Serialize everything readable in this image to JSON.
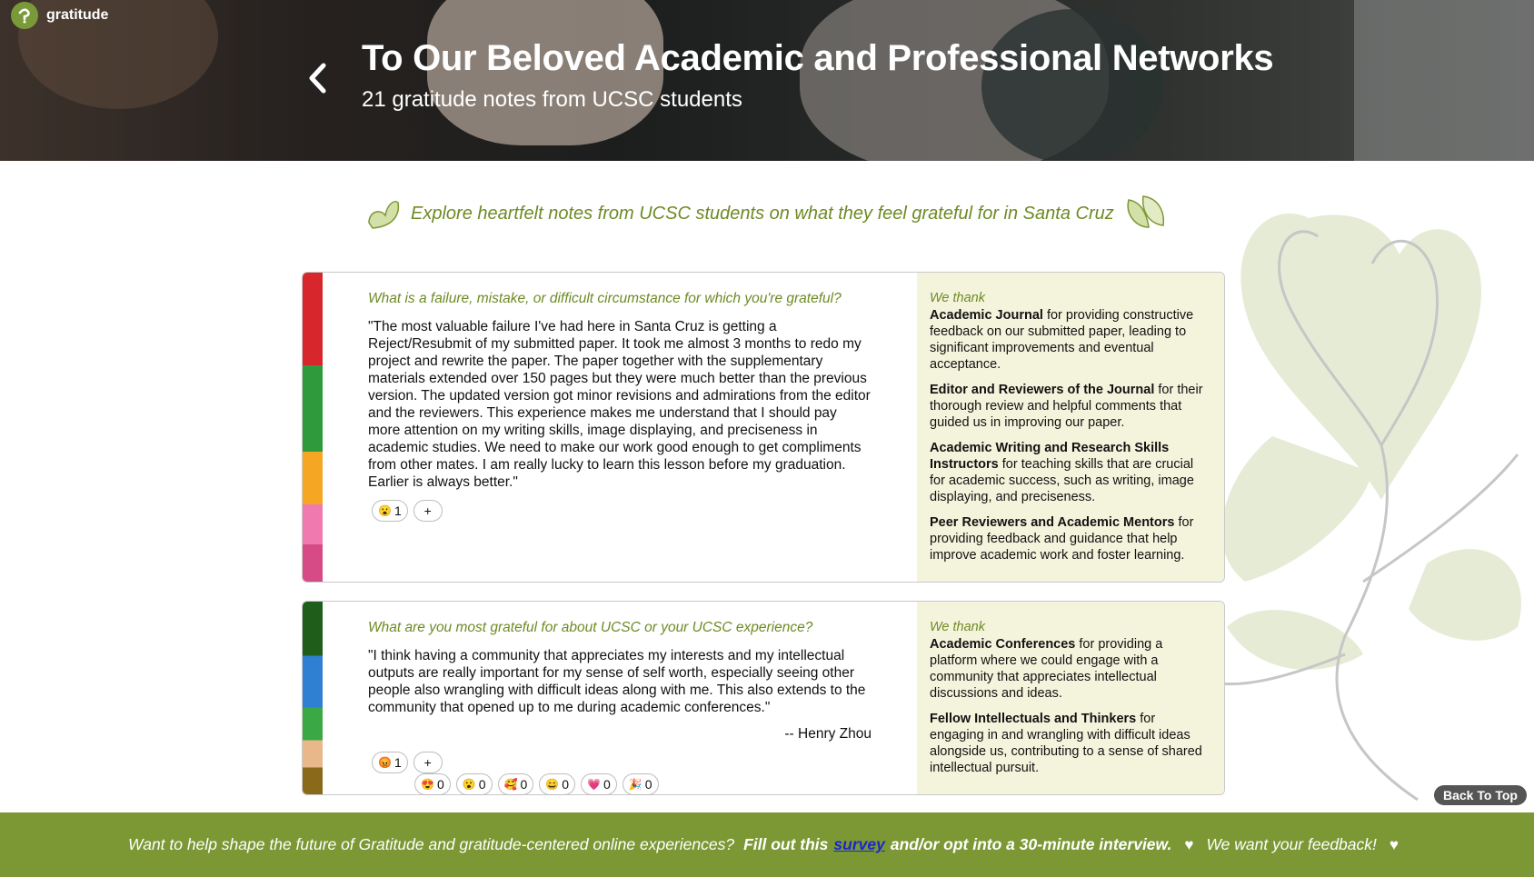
{
  "brand": {
    "name": "gratitude"
  },
  "header": {
    "title": "To Our Beloved Academic and Professional Networks",
    "subtitle": "21 gratitude notes from UCSC students"
  },
  "tagline": "Explore heartfelt notes from UCSC students on what they feel grateful for in Santa Cruz",
  "cards": [
    {
      "question": "What is a failure, mistake, or difficult circumstance for which you're grateful?",
      "answer": "\"The most valuable failure I've had here in Santa Cruz is getting a Reject/Resubmit of my submitted paper. It took me almost 3 months to redo my project and rewrite the paper. The paper together with the supplementary materials extended over 150 pages but they were much better than the previous version. The updated version got minor revisions and admirations from the editor and the reviewers. This experience makes me understand that I should pay more attention on my writing skills, image displaying, and preciseness in academic studies. We need to make our work good enough to get compliments from other mates. I am really lucky to learn this lesson before my graduation. Earlier is always better.\"",
      "reaction": {
        "emoji": "😮",
        "count": "1"
      },
      "add_label": "+",
      "we_thank_label": "We thank",
      "thanks": [
        {
          "name": "Academic Journal",
          "text": " for providing constructive feedback on our submitted paper, leading to significant improvements and eventual acceptance."
        },
        {
          "name": "Editor and Reviewers of the Journal",
          "text": " for their thorough review and helpful comments that guided us in improving our paper."
        },
        {
          "name": "Academic Writing and Research Skills Instructors",
          "text": " for teaching skills that are crucial for academic success, such as writing, image displaying, and preciseness."
        },
        {
          "name": "Peer Reviewers and Academic Mentors",
          "text": " for providing feedback and guidance that help improve academic work and foster learning."
        }
      ]
    },
    {
      "question": "What are you most grateful for about UCSC or your UCSC experience?",
      "answer": "\"I think having a community that appreciates my interests and my intellectual outputs are really important for my sense of self worth, especially seeing other people also wrangling with difficult ideas along with me. This also extends to the community that opened up to me during academic conferences.\"",
      "author": "-- Henry Zhou",
      "reaction": {
        "emoji": "😡",
        "count": "1"
      },
      "add_label": "+",
      "picker": [
        {
          "emoji": "😍",
          "count": "0"
        },
        {
          "emoji": "😮",
          "count": "0"
        },
        {
          "emoji": "🥰",
          "count": "0"
        },
        {
          "emoji": "😄",
          "count": "0"
        },
        {
          "emoji": "💗",
          "count": "0"
        },
        {
          "emoji": "🎉",
          "count": "0"
        }
      ],
      "we_thank_label": "We thank",
      "thanks": [
        {
          "name": "Academic Conferences",
          "text": " for providing a platform where we could engage with a community that appreciates intellectual discussions and ideas."
        },
        {
          "name": "Fellow Intellectuals and Thinkers",
          "text": " for engaging in and wrangling with difficult ideas alongside us, contributing to a sense of shared intellectual pursuit."
        }
      ]
    }
  ],
  "back_to_top": "Back To Top",
  "footer": {
    "lead": "Want to help shape the future of Gratitude and gratitude-centered online experiences?",
    "cta_prefix": "Fill out this",
    "survey_link": "survey",
    "cta_suffix": "and/or opt into a 30-minute interview.",
    "feedback": "We want your feedback!"
  },
  "colors": {
    "accent_green": "#7c9834",
    "question_green": "#6e8a24",
    "side_panel": "#f4f4dd"
  }
}
